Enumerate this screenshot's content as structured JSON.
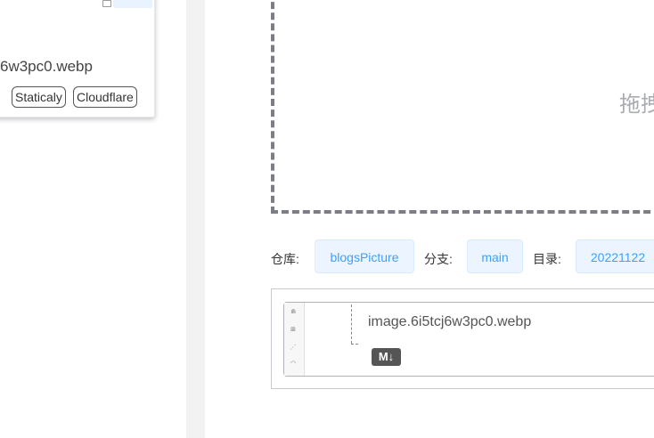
{
  "left_panel": {
    "filename": "6w3pc0.webp",
    "cdn_buttons": [
      "Staticaly",
      "Cloudflare"
    ]
  },
  "upload": {
    "drop_text": "拖拽"
  },
  "repo_info": {
    "repo_label": "仓库:",
    "repo_value": "blogsPicture",
    "branch_label": "分支:",
    "branch_value": "main",
    "dir_label": "目录:",
    "dir_value": "20221122"
  },
  "result": {
    "filename": "image.6i5tcj6w3pc0.webp",
    "md_icon_label": "M↓"
  },
  "colors": {
    "accent": "#409eff",
    "tag_bg": "#ecf5ff",
    "dashed_border": "#7d7d85"
  }
}
